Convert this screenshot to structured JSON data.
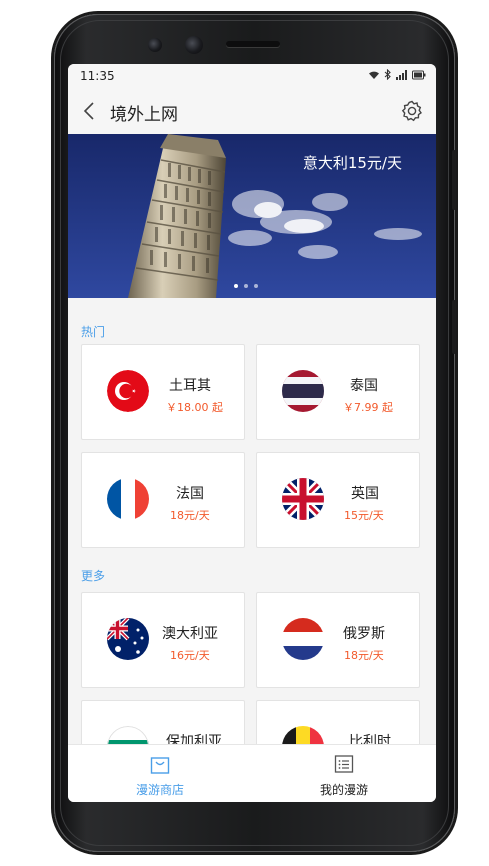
{
  "status": {
    "time": "11:35"
  },
  "header": {
    "title": "境外上网"
  },
  "banner": {
    "caption": "意大利15元/天",
    "dots": 3,
    "active_dot": 0
  },
  "sections": {
    "hot": "热门",
    "more": "更多"
  },
  "hot": [
    {
      "name": "土耳其",
      "price": "￥18.00 起",
      "flag": "turkey-flag"
    },
    {
      "name": "泰国",
      "price": "￥7.99 起",
      "flag": "thailand-flag"
    },
    {
      "name": "法国",
      "price": "18元/天",
      "flag": "france-flag"
    },
    {
      "name": "英国",
      "price": "15元/天",
      "flag": "uk-flag"
    }
  ],
  "more": [
    {
      "name": "澳大利亚",
      "price": "16元/天",
      "flag": "australia-flag"
    },
    {
      "name": "俄罗斯",
      "price": "18元/天",
      "flag": "russia-flag"
    },
    {
      "name": "保加利亚",
      "flag": "bulgaria-flag"
    },
    {
      "name": "比利时",
      "flag": "belgium-flag"
    }
  ],
  "tabs": [
    {
      "label": "漫游商店",
      "icon": "shopping-bag-icon",
      "active": true
    },
    {
      "label": "我的漫游",
      "icon": "list-icon",
      "active": false
    }
  ],
  "colors": {
    "accent": "#4a9ee8",
    "price": "#f25a2c",
    "banner_sky": "#21337a"
  }
}
